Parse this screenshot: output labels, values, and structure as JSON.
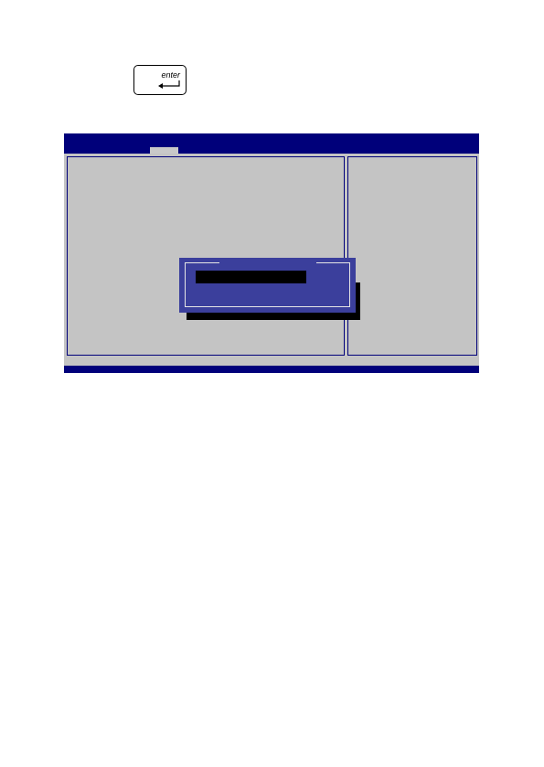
{
  "enter_key": {
    "label": "enter",
    "icon": "enter-arrow-icon"
  },
  "bios": {
    "colors": {
      "background": "#00007a",
      "panel": "#c4c4c4",
      "active_tab": "#c9c9c9",
      "dialog": "#3b3f9c",
      "input": "#000000"
    },
    "dialog": {
      "title": "",
      "input_value": ""
    }
  }
}
